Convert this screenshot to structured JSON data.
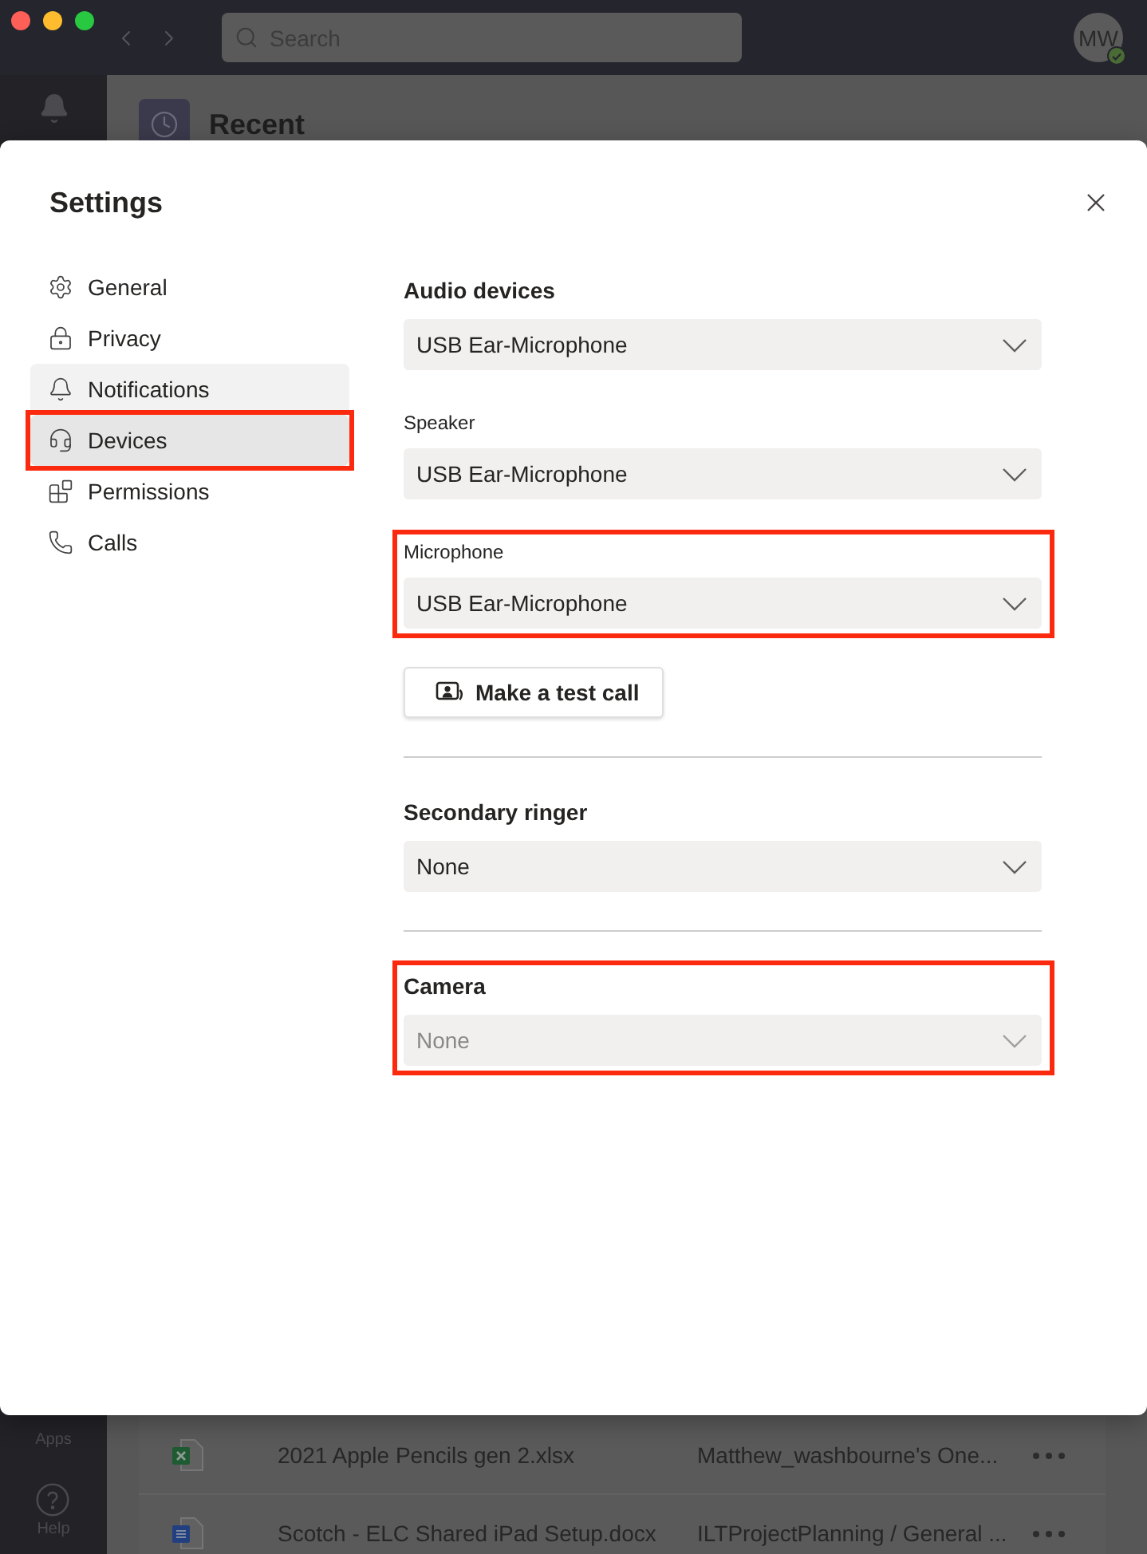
{
  "titlebar": {
    "search": {
      "placeholder": "Search"
    },
    "avatar": {
      "initials": "MW",
      "available": true
    }
  },
  "app": {
    "page_title": "Recent",
    "rail": [
      {
        "label": "Apps"
      },
      {
        "label": "Help"
      }
    ],
    "files": [
      {
        "kind": "spreadsheet",
        "name": "2021 Apple Pencils gen 2.xlsx",
        "location": "Matthew_washbourne's One..."
      },
      {
        "kind": "document",
        "name": "Scotch - ELC Shared iPad Setup.docx",
        "location": "ILTProjectPlanning / General ..."
      }
    ]
  },
  "settings": {
    "title": "Settings",
    "nav": [
      {
        "label": "General",
        "selected": false,
        "hovered": false,
        "highlighted": false
      },
      {
        "label": "Privacy",
        "selected": false,
        "hovered": false,
        "highlighted": false
      },
      {
        "label": "Notifications",
        "selected": false,
        "hovered": true,
        "highlighted": false
      },
      {
        "label": "Devices",
        "selected": true,
        "hovered": false,
        "highlighted": true
      },
      {
        "label": "Permissions",
        "selected": false,
        "hovered": false,
        "highlighted": false
      },
      {
        "label": "Calls",
        "selected": false,
        "hovered": false,
        "highlighted": false
      }
    ],
    "sections": [
      {
        "heading": "Audio devices",
        "highlighted": false,
        "fields": [
          {
            "value": "USB Ear-Microphone",
            "disabled": false,
            "highlighted": false
          },
          {
            "label": "Speaker",
            "value": "USB Ear-Microphone",
            "disabled": false,
            "highlighted": false
          },
          {
            "label": "Microphone",
            "value": "USB Ear-Microphone",
            "disabled": false,
            "highlighted": true
          }
        ],
        "button": "Make a test call"
      },
      {
        "heading": "Secondary ringer",
        "highlighted": false,
        "fields": [
          {
            "value": "None",
            "disabled": false,
            "highlighted": false
          }
        ]
      },
      {
        "heading": "Camera",
        "highlighted": true,
        "fields": [
          {
            "value": "None",
            "disabled": true,
            "highlighted": false
          }
        ]
      }
    ]
  }
}
